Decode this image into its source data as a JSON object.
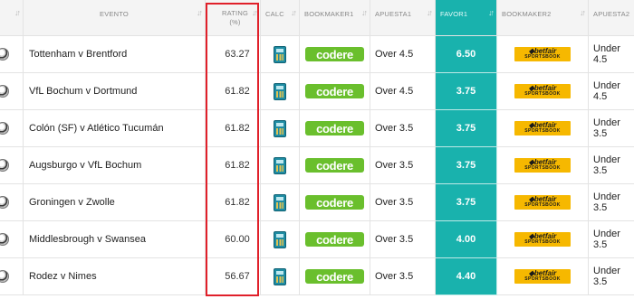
{
  "headers": {
    "sort_icon": "↓↑",
    "evento": "EVENTO",
    "rating_line1": "RATING",
    "rating_line2": "(%)",
    "calc": "CALC",
    "bookmaker1": "BOOKMAKER1",
    "apuesta1": "APUESTA1",
    "favor1": "FAVOR1",
    "bookmaker2": "BOOKMAKER2",
    "apuesta2": "APUESTA2"
  },
  "rows": [
    {
      "evento": "Tottenham v Brentford",
      "rating": "63.27",
      "bookmaker1": "codere",
      "apuesta1": "Over 4.5",
      "favor1": "6.50",
      "bookmaker2": "betfair",
      "apuesta2": "Under 4.5"
    },
    {
      "evento": "VfL Bochum v Dortmund",
      "rating": "61.82",
      "bookmaker1": "codere",
      "apuesta1": "Over 4.5",
      "favor1": "3.75",
      "bookmaker2": "betfair",
      "apuesta2": "Under 4.5"
    },
    {
      "evento": "Colón (SF) v Atlético Tucumán",
      "rating": "61.82",
      "bookmaker1": "codere",
      "apuesta1": "Over 3.5",
      "favor1": "3.75",
      "bookmaker2": "betfair",
      "apuesta2": "Under 3.5"
    },
    {
      "evento": "Augsburgo v VfL Bochum",
      "rating": "61.82",
      "bookmaker1": "codere",
      "apuesta1": "Over 3.5",
      "favor1": "3.75",
      "bookmaker2": "betfair",
      "apuesta2": "Under 3.5"
    },
    {
      "evento": "Groningen v Zwolle",
      "rating": "61.82",
      "bookmaker1": "codere",
      "apuesta1": "Over 3.5",
      "favor1": "3.75",
      "bookmaker2": "betfair",
      "apuesta2": "Under 3.5"
    },
    {
      "evento": "Middlesbrough v Swansea",
      "rating": "60.00",
      "bookmaker1": "codere",
      "apuesta1": "Over 3.5",
      "favor1": "4.00",
      "bookmaker2": "betfair",
      "apuesta2": "Under 3.5"
    },
    {
      "evento": "Rodez v Nimes",
      "rating": "56.67",
      "bookmaker1": "codere",
      "apuesta1": "Over 3.5",
      "favor1": "4.40",
      "bookmaker2": "betfair",
      "apuesta2": "Under 3.5"
    }
  ],
  "logos": {
    "betfair_line1": "◆betfair",
    "betfair_line2": "SPORTSBOOK"
  },
  "icons": {
    "ball": "soccer-ball-icon",
    "calc": "calculator-icon"
  },
  "colors": {
    "favor_bg": "#19b2ad",
    "codere_green": "#6abf2d",
    "betfair_yellow": "#f6b800",
    "highlight_red": "#e0202a"
  }
}
